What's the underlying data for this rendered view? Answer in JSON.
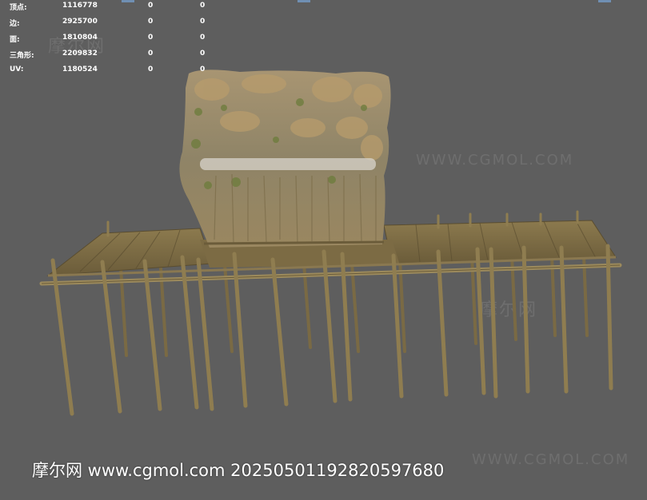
{
  "stats": {
    "rows": [
      {
        "label": "顶点:",
        "v1": "1116778",
        "v2": "0",
        "v3": "0"
      },
      {
        "label": "边:",
        "v1": "2925700",
        "v2": "0",
        "v3": "0"
      },
      {
        "label": "面:",
        "v1": "1810804",
        "v2": "0",
        "v3": "0"
      },
      {
        "label": "三角形:",
        "v1": "2209832",
        "v2": "0",
        "v3": "0"
      },
      {
        "label": "UV:",
        "v1": "1180524",
        "v2": "0",
        "v3": "0"
      }
    ]
  },
  "watermarks": {
    "site_top": "WWW.CGMOL.COM",
    "site_bottom": "WWW.CGMOL.COM",
    "brand_mark": "摩尔网"
  },
  "footer": {
    "text": "摩尔网 www.cgmol.com 20250501192820597680"
  },
  "colors": {
    "background": "#5e5e5e",
    "wood_light": "#9c8a5c",
    "wood_dark": "#6b5c3a",
    "thatch": "#a08c66",
    "moss": "#6f7d3e"
  }
}
